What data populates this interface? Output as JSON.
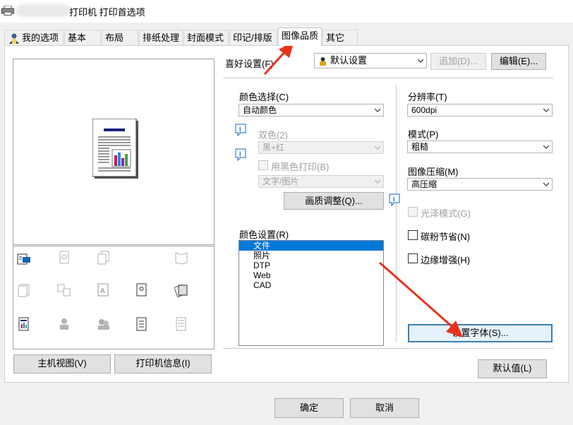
{
  "window": {
    "title": "打印机 打印首选项"
  },
  "tabs": [
    "我的选项",
    "基本",
    "布局",
    "排纸处理",
    "封面模式",
    "印记/排版",
    "图像品质",
    "其它"
  ],
  "active_tab": "图像品质",
  "favorites": {
    "label": "喜好设置(F)",
    "value": "默认设置",
    "add_button": "追加(D)...",
    "edit_button": "编辑(E)..."
  },
  "left_panel": {
    "host_view_button": "主机视图(V)",
    "printer_info_button": "打印机信息(I)"
  },
  "color": {
    "select_label": "颜色选择(C)",
    "select_value": "自动颜色",
    "two_color_label": "双色(2)",
    "two_color_value": "黑+红",
    "black_print_label": "用黑色打印(B)",
    "black_print_value": "文字/图片",
    "quality_adjust_button": "画质调整(Q)...",
    "settings_label": "颜色设置(R)",
    "settings_items": [
      "文件",
      "照片",
      "DTP",
      "Web",
      "CAD"
    ],
    "settings_selected": "文件"
  },
  "right": {
    "resolution_label": "分辨率(T)",
    "resolution_value": "600dpi",
    "mode_label": "模式(P)",
    "mode_value": "粗糙",
    "compression_label": "图像压缩(M)",
    "compression_value": "高压缩",
    "gloss_label": "光泽模式(G)",
    "toner_save_label": "碳粉节省(N)",
    "edge_enhance_label": "边缘增强(H)",
    "font_settings_button": "设置字体(S)..."
  },
  "defaults_button": "默认值(L)",
  "footer": {
    "ok_button": "确定",
    "cancel_button": "取消"
  },
  "colors": {
    "annotation_arrow": "#e8321e",
    "selection": "#0078d7"
  }
}
